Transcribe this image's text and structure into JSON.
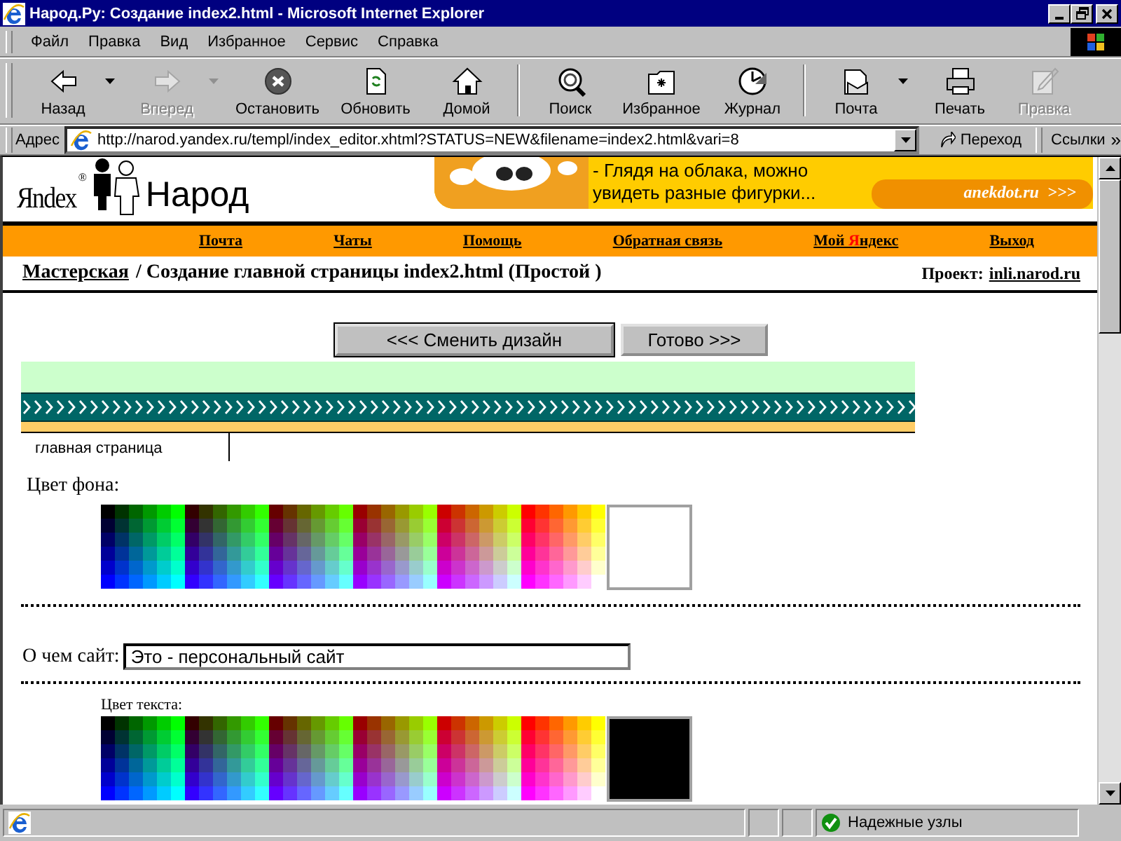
{
  "window": {
    "title": "Народ.Ру: Создание index2.html - Microsoft Internet Explorer"
  },
  "menu": [
    "Файл",
    "Правка",
    "Вид",
    "Избранное",
    "Сервис",
    "Справка"
  ],
  "toolbar": [
    {
      "label": "Назад",
      "disabled": false,
      "dropdown": true
    },
    {
      "label": "Вперед",
      "disabled": true,
      "dropdown": true
    },
    {
      "label": "Остановить",
      "disabled": false,
      "dropdown": false
    },
    {
      "label": "Обновить",
      "disabled": false,
      "dropdown": false
    },
    {
      "label": "Домой",
      "disabled": false,
      "dropdown": false
    },
    {
      "label": "Поиск",
      "disabled": false,
      "dropdown": false
    },
    {
      "label": "Избранное",
      "disabled": false,
      "dropdown": false
    },
    {
      "label": "Журнал",
      "disabled": false,
      "dropdown": false
    },
    {
      "label": "Почта",
      "disabled": false,
      "dropdown": true
    },
    {
      "label": "Печать",
      "disabled": false,
      "dropdown": false
    },
    {
      "label": "Правка",
      "disabled": true,
      "dropdown": false
    }
  ],
  "address": {
    "label": "Адрес",
    "value": "http://narod.yandex.ru/templ/index_editor.xhtml?STATUS=NEW&filename=index2.html&vari=8",
    "go": "Переход",
    "links": "Ссылки",
    "links_more": "»"
  },
  "logo": {
    "brand": "Яndex",
    "mark": "®",
    "name": "Народ"
  },
  "banner": {
    "text": "- Глядя на облака, можно увидеть разные фигурки...",
    "site": "anekdot.ru",
    "more": ">>>"
  },
  "nav": [
    {
      "parts": [
        {
          "text": "Почта"
        }
      ]
    },
    {
      "parts": [
        {
          "text": "Чаты"
        }
      ]
    },
    {
      "parts": [
        {
          "text": "Помощь"
        }
      ]
    },
    {
      "parts": [
        {
          "text": "Обратная связь"
        }
      ]
    },
    {
      "parts": [
        {
          "text": "Мой "
        },
        {
          "text": "Я",
          "color": "#ff0000"
        },
        {
          "text": "ндекс"
        }
      ]
    },
    {
      "parts": [
        {
          "text": "Выход"
        }
      ]
    }
  ],
  "breadcrumb": {
    "link": "Мастерская",
    "title": "/ Создание главной страницы index2.html (Простой )",
    "project_label": "Проект:",
    "project_link": "inli.narod.ru"
  },
  "buttons": [
    "<<< Сменить дизайн",
    "Готово >>>"
  ],
  "preview": {
    "tab": "главная страница"
  },
  "background_color": {
    "label": "Цвет фона:",
    "color": "#ffffff"
  },
  "about": {
    "label": "О чем сайт:",
    "value": "Это - персональный сайт "
  },
  "text_color": {
    "label": "Цвет текста:",
    "color": "#000000"
  },
  "status_bar": {
    "zone": "Надежные узлы"
  }
}
